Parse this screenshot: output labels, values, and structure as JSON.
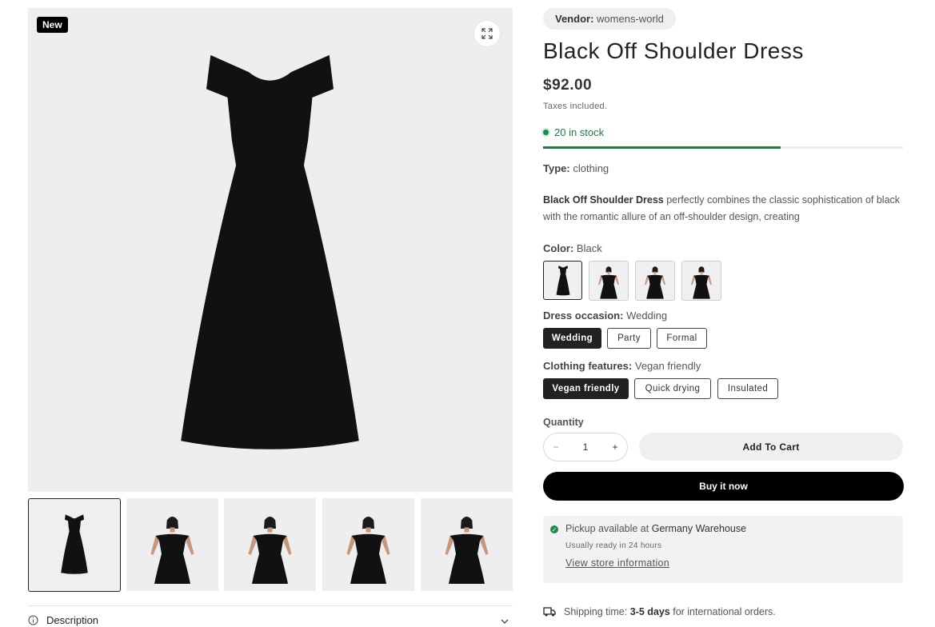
{
  "gallery": {
    "badge": "New",
    "zoom_icon": "expand-icon",
    "thumbnails": [
      {
        "name": "dress-flat"
      },
      {
        "name": "model-front"
      },
      {
        "name": "model-back"
      },
      {
        "name": "model-front-2"
      },
      {
        "name": "model-side"
      }
    ]
  },
  "accordion": {
    "description_label": "Description"
  },
  "product": {
    "vendor_label": "Vendor:",
    "vendor": "womens-world",
    "title": "Black Off Shoulder Dress",
    "price": "$92.00",
    "taxes": "Taxes included.",
    "stock": "20 in stock",
    "stock_fraction": 0.66,
    "type_label": "Type:",
    "type": "clothing",
    "blurb_bold": "Black Off Shoulder Dress",
    "blurb_rest": "perfectly combines the classic sophistication of black with the romantic allure of an off-shoulder design, creating"
  },
  "options": {
    "color_label": "Color:",
    "color_value": "Black",
    "occasion_label": "Dress occasion:",
    "occasion_value": "Wedding",
    "occasions": [
      "Wedding",
      "Party",
      "Formal"
    ],
    "features_label": "Clothing features:",
    "features_value": "Vegan friendly",
    "features": [
      "Vegan friendly",
      "Quick drying",
      "Insulated"
    ]
  },
  "purchase": {
    "quantity_label": "Quantity",
    "quantity": "1",
    "minus": "−",
    "plus": "+",
    "add_to_cart": "Add To Cart",
    "buy_now": "Buy it now"
  },
  "pickup": {
    "prefix": "Pickup available at",
    "location": "Germany Warehouse",
    "ready": "Usually ready in 24 hours",
    "link": "View store information"
  },
  "shipping": {
    "prefix": "Shipping time:",
    "days": "3-5 days",
    "suffix": "for international orders."
  },
  "colors": {
    "accent_green": "#1f7a3f",
    "button_black": "#000000"
  }
}
